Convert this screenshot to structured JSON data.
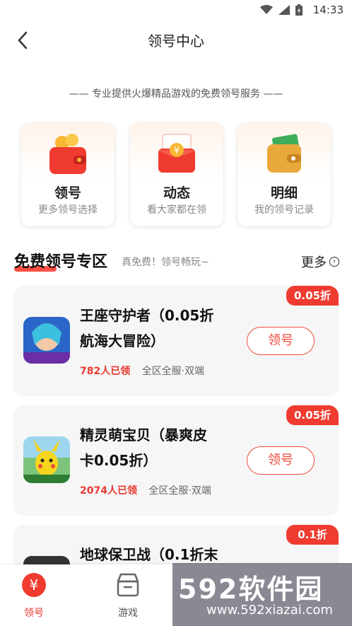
{
  "status_bar": {
    "time": "14:33"
  },
  "header": {
    "title": "领号中心"
  },
  "slogan": "—— 专业提供火爆精品游戏的免费领号服务 ——",
  "quick_entries": [
    {
      "title": "领号",
      "subtitle": "更多领号选择",
      "icon": "wallet-icon"
    },
    {
      "title": "动态",
      "subtitle": "看大家都在领",
      "icon": "red-envelope-icon"
    },
    {
      "title": "明细",
      "subtitle": "我的领号记录",
      "icon": "money-wallet-icon"
    }
  ],
  "section": {
    "title": "免费领号专区",
    "subtitle": "真免费！领号畅玩~",
    "more_label": "更多"
  },
  "games": [
    {
      "name": "王座守护者（0.05折航海大冒险）",
      "name_line1": "王座守护者（0.05折",
      "name_line2": "航海大冒险）",
      "claimed": "782人已领",
      "servers": "全区全服·双端",
      "discount": "0.05折",
      "button": "领号"
    },
    {
      "name": "精灵萌宝贝（暴爽皮卡0.05折）",
      "name_line1": "精灵萌宝贝（暴爽皮",
      "name_line2": "卡0.05折）",
      "claimed": "2074人已领",
      "servers": "全区全服·双端",
      "discount": "0.05折",
      "button": "领号"
    },
    {
      "name": "地球保卫战（0.1折末",
      "name_line1": "地球保卫战（0.1折末",
      "name_line2": "",
      "claimed": "",
      "servers": "",
      "discount": "0.1折",
      "button": ""
    }
  ],
  "bottom_nav": [
    {
      "label": "领号",
      "icon": "yen-coin-icon",
      "active": true
    },
    {
      "label": "游戏",
      "icon": "game-box-icon",
      "active": false
    }
  ],
  "watermark": {
    "brand": "592软件园",
    "url": "www.592xiazai.com"
  },
  "colors": {
    "accent": "#ef3b30",
    "card_bg": "#f6f6f6"
  }
}
